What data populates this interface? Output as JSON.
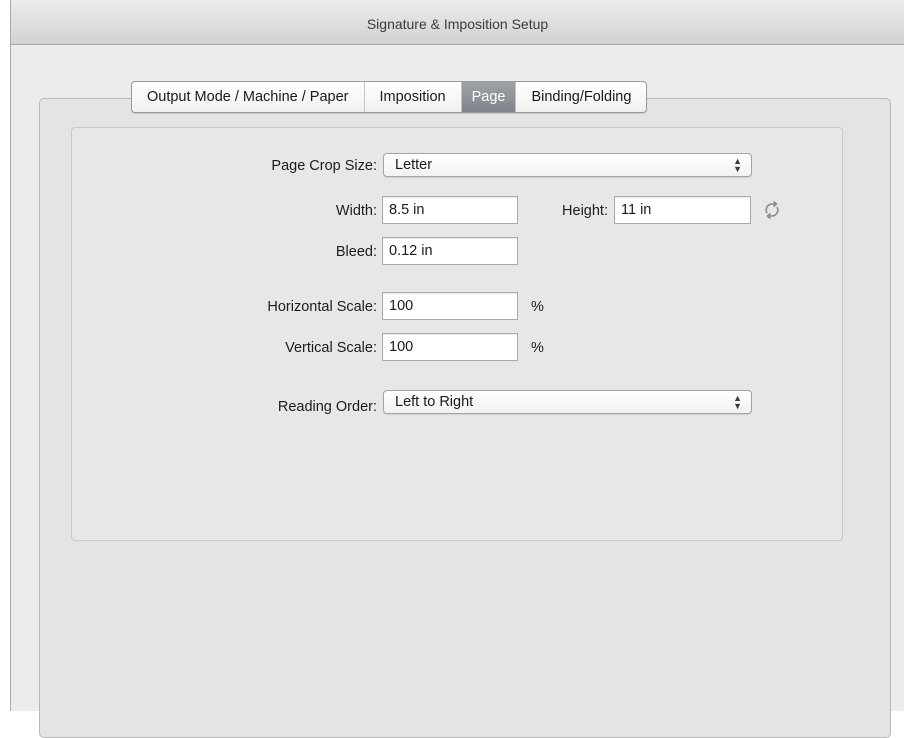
{
  "window": {
    "title": "Signature & Imposition Setup"
  },
  "tabs": [
    {
      "label": "Output Mode / Machine / Paper",
      "active": false
    },
    {
      "label": "Imposition",
      "active": false
    },
    {
      "label": "Page",
      "active": true
    },
    {
      "label": "Binding/Folding",
      "active": false
    }
  ],
  "page_crop_size": {
    "label": "Page Crop Size:",
    "value": "Letter"
  },
  "width": {
    "label": "Width:",
    "value": "8.5 in"
  },
  "height": {
    "label": "Height:",
    "value": "11 in"
  },
  "bleed": {
    "label": "Bleed:",
    "value": "0.12 in"
  },
  "horizontal_scale": {
    "label": "Horizontal Scale:",
    "value": "100",
    "unit": "%"
  },
  "vertical_scale": {
    "label": "Vertical Scale:",
    "value": "100",
    "unit": "%"
  },
  "reading_order": {
    "label": "Reading Order:",
    "value": "Left to Right"
  },
  "icons": {
    "swap": "swap-orientation-icon",
    "popup_arrows": "up-down-arrows-icon"
  },
  "colors": {
    "active_tab": "#8d9299",
    "window_bg": "#ececec"
  }
}
